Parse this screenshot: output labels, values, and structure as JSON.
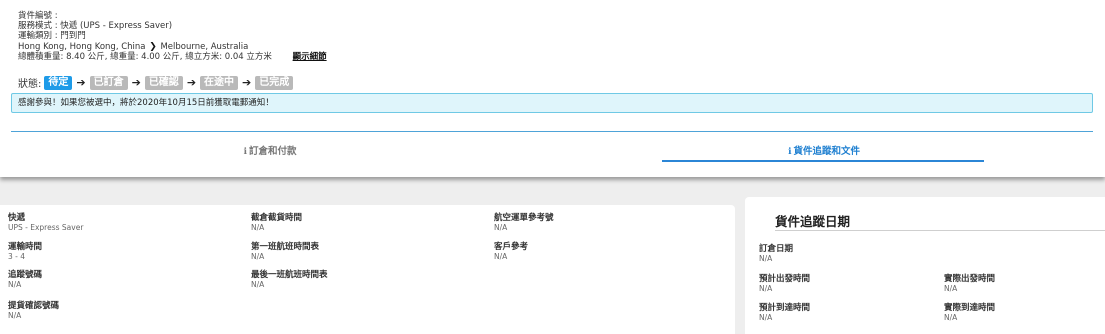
{
  "shipment": {
    "number_label": "貨件編號 :",
    "service_label": "服務模式 : 快遞 (UPS - Express Saver)",
    "transport_label": "運輸類別 : 門到門",
    "route_from": "Hong Kong, Hong Kong, China",
    "route_to": "Melbourne, Australia",
    "weights": "總體積重量: 8.40 公斤, 總重量: 4.00 公斤, 總立方米: 0.04 立方米",
    "detail_link": "顯示細節"
  },
  "status": {
    "label": "狀態:",
    "steps": [
      {
        "label": "待定",
        "active": true
      },
      {
        "label": "已訂倉",
        "active": false
      },
      {
        "label": "已確認",
        "active": false
      },
      {
        "label": "在途中",
        "active": false
      },
      {
        "label": "已完成",
        "active": false
      }
    ]
  },
  "notice": "感謝參與！如果您被選中，將於2020年10月15日前獲取電郵通知！",
  "tabs": {
    "order": "訂倉和付款",
    "tracking": "貨件追蹤和文件"
  },
  "details": {
    "express": {
      "label": "快遞",
      "value": "UPS - Express Saver"
    },
    "transit": {
      "label": "運輸時間",
      "value": "3 - 4"
    },
    "tracking_no": {
      "label": "追蹤號碼",
      "value": "N/A"
    },
    "pickup_no": {
      "label": "提貨確認號碼",
      "value": "N/A"
    },
    "cutoff": {
      "label": "截倉截貨時間",
      "value": "N/A"
    },
    "first_flight": {
      "label": "第一班航班時間表",
      "value": "N/A"
    },
    "last_flight": {
      "label": "最後一班航班時間表",
      "value": "N/A"
    },
    "awb": {
      "label": "航空運單參考號",
      "value": "N/A"
    },
    "customer_ref": {
      "label": "客戶參考",
      "value": "N/A"
    }
  },
  "tracking_dates": {
    "title": "貨件追蹤日期",
    "booking_date": {
      "label": "訂倉日期",
      "value": "N/A"
    },
    "est_departure": {
      "label": "預計出發時間",
      "value": "N/A"
    },
    "act_departure": {
      "label": "實際出發時間",
      "value": "N/A"
    },
    "est_arrival": {
      "label": "預計到達時間",
      "value": "N/A"
    },
    "act_arrival": {
      "label": "實際到達時間",
      "value": "N/A"
    }
  },
  "colors": {
    "accent": "#1e9be8",
    "inactive_step": "#b9b9b9",
    "notice_bg": "#dff5fb"
  }
}
